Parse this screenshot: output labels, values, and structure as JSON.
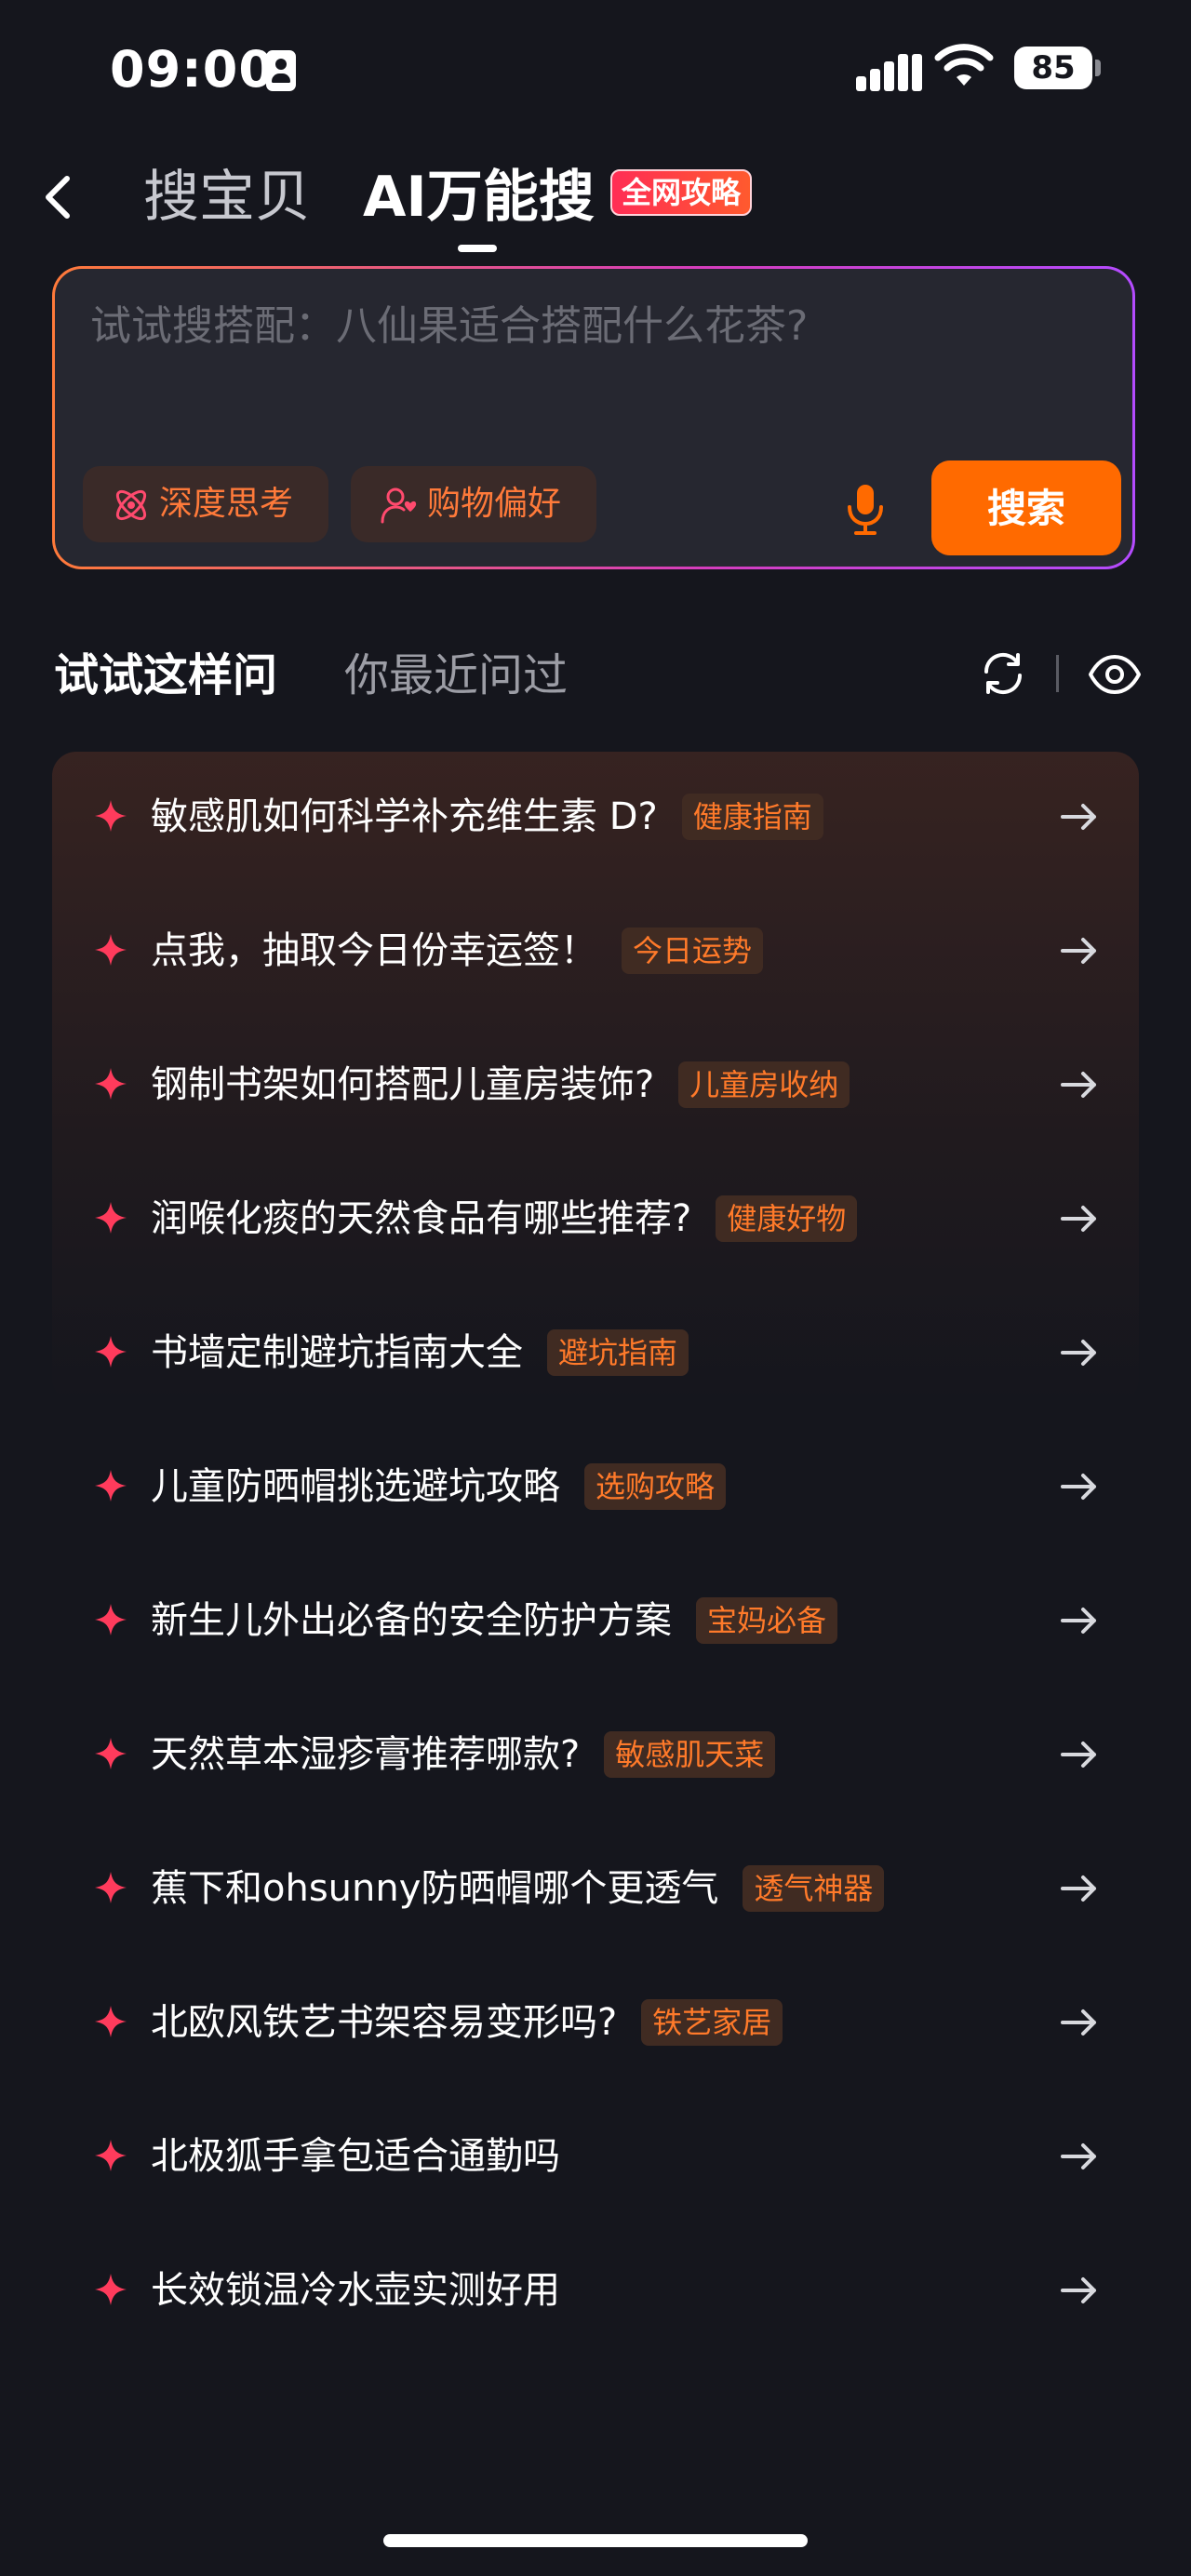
{
  "status_bar": {
    "time": "09:00",
    "battery": "85"
  },
  "header": {
    "tabs": [
      {
        "label": "搜宝贝"
      },
      {
        "label": "AI万能搜"
      }
    ],
    "badge": "全网攻略"
  },
  "search": {
    "placeholder": "试试搜搭配：八仙果适合搭配什么花茶?",
    "chips": [
      {
        "label": "深度思考",
        "icon": "atom-icon"
      },
      {
        "label": "购物偏好",
        "icon": "user-heart-icon"
      }
    ],
    "button_label": "搜索"
  },
  "section_tabs": {
    "try_label": "试试这样问",
    "recent_label": "你最近问过"
  },
  "suggestions": [
    {
      "text": "敏感肌如何科学补充维生素 D?",
      "tag": "健康指南"
    },
    {
      "text": "点我，抽取今日份幸运签！",
      "tag": "今日运势"
    },
    {
      "text": "钢制书架如何搭配儿童房装饰?",
      "tag": "儿童房收纳"
    },
    {
      "text": "润喉化痰的天然食品有哪些推荐?",
      "tag": "健康好物"
    },
    {
      "text": "书墙定制避坑指南大全",
      "tag": "避坑指南"
    },
    {
      "text": "儿童防晒帽挑选避坑攻略",
      "tag": "选购攻略"
    },
    {
      "text": "新生儿外出必备的安全防护方案",
      "tag": "宝妈必备"
    },
    {
      "text": "天然草本湿疹膏推荐哪款?",
      "tag": "敏感肌天菜"
    },
    {
      "text": "蕉下和ohsunny防晒帽哪个更透气",
      "tag": "透气神器"
    },
    {
      "text": "北欧风铁艺书架容易变形吗?",
      "tag": "铁艺家居"
    },
    {
      "text": "北极狐手拿包适合通勤吗",
      "tag": ""
    },
    {
      "text": "长效锁温冷水壶实测好用",
      "tag": ""
    }
  ],
  "colors": {
    "background": "#15161d",
    "accent": "#ff6a00",
    "tag_text": "#ff7a2a",
    "spark": "#ff3b5c"
  }
}
